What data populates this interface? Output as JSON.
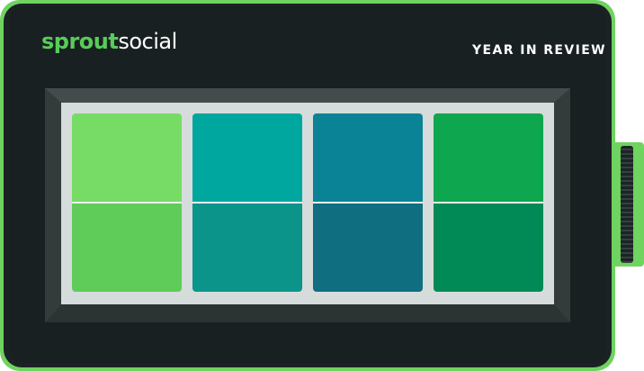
{
  "brand": {
    "name_bold": "sprout",
    "name_light": "social",
    "accent": "#59cb59"
  },
  "header": {
    "title": "YEAR IN REVIEW"
  },
  "tiles": [
    {
      "top": "#76dc66",
      "bottom": "#5fcb59"
    },
    {
      "top": "#00a79e",
      "bottom": "#0b958a"
    },
    {
      "top": "#0a8396",
      "bottom": "#0f6e80"
    },
    {
      "top": "#0ea64e",
      "bottom": "#018a55"
    }
  ],
  "colors": {
    "bezel": "#6fd35f",
    "body": "#1b2223",
    "frame": "#3a4342",
    "screen": "#d6dbdb"
  }
}
